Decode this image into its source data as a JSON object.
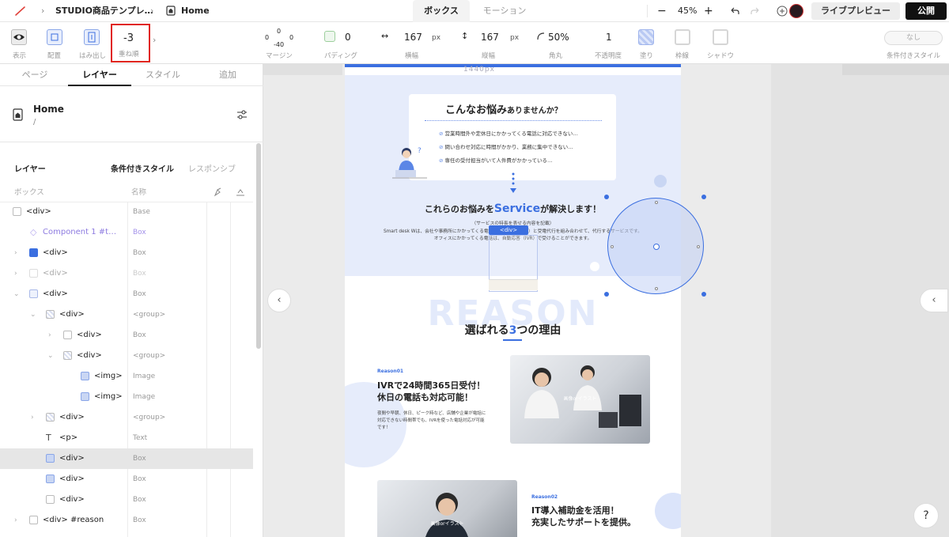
{
  "topbar": {
    "breadcrumb_project": "STUDIO商品テンプレ…",
    "breadcrumb_page": "Home",
    "tab_box": "ボックス",
    "tab_motion": "モーション",
    "zoom_minus": "−",
    "zoom": "45%",
    "zoom_plus": "+",
    "live_preview": "ライブプレビュー",
    "publish": "公開"
  },
  "toolbar": {
    "show": "表示",
    "place": "配置",
    "overflow": "はみ出し",
    "zindex_value": "-3",
    "zindex_label": "重ね順",
    "margin_top": "0",
    "margin_left": "0",
    "margin_right": "0",
    "margin_bottom": "-40",
    "margin_label": "マージン",
    "padding_value": "0",
    "padding_label": "パディング",
    "width_value": "167",
    "width_unit": "px",
    "width_label": "横幅",
    "height_value": "167",
    "height_unit": "px",
    "height_label": "縦幅",
    "radius_value": "50%",
    "radius_label": "角丸",
    "opacity_value": "1",
    "opacity_label": "不透明度",
    "fill_label": "塗り",
    "border_label": "枠線",
    "shadow_label": "シャドウ",
    "conditional_value": "なし",
    "conditional_label": "条件付きスタイル"
  },
  "panel": {
    "tabs": [
      "ページ",
      "レイヤー",
      "スタイル",
      "追加"
    ],
    "page_title": "Home",
    "page_path": "/",
    "section_title": "レイヤー",
    "subtab_conditional": "条件付きスタイル",
    "subtab_responsive": "レスポンシブ",
    "col_box": "ボックス",
    "col_name": "名称",
    "rows": [
      {
        "name": "<div>",
        "type": "Base"
      },
      {
        "name": "Component 1 #t…",
        "type": "Box"
      },
      {
        "name": "<div>",
        "type": "Box"
      },
      {
        "name": "<div>",
        "type": "Box"
      },
      {
        "name": "<div>",
        "type": "Box"
      },
      {
        "name": "<div>",
        "type": "<group>"
      },
      {
        "name": "<div>",
        "type": "Box"
      },
      {
        "name": "<div>",
        "type": "<group>"
      },
      {
        "name": "<img>",
        "type": "Image"
      },
      {
        "name": "<img>",
        "type": "Image"
      },
      {
        "name": "<div>",
        "type": "<group>"
      },
      {
        "name": "<p>",
        "type": "Text"
      },
      {
        "name": "<div>",
        "type": "Box"
      },
      {
        "name": "<div>",
        "type": "Box"
      },
      {
        "name": "<div>",
        "type": "Box"
      },
      {
        "name": "<div> #reason",
        "type": "Box"
      }
    ]
  },
  "canvas": {
    "width_label": "1440px",
    "worry_title_a": "こんなお悩み",
    "worry_title_b": "ありませんか？",
    "worries": [
      "営業時間外や定休日にかかってくる電話に対応できない…",
      "問い合わせ対応に時間がかかり、業務に集中できない…",
      "専任の受付担当がいて人件費がかかっている…"
    ],
    "solve_a": "これらのお悩みを",
    "solve_b": "Service",
    "solve_c": "が解決します！",
    "solve_sub1": "（サービスの特長を表せる内容を記載）",
    "solve_sub2": "Smart desk Wは、会社や事務所にかかってくる電話を自動応答（IVR）と受電代行を組み合わせて、代行するサービスです。",
    "solve_sub3": "オフィスにかかってくる電話は、自動応答（IVR）で受けることができます。",
    "div_tag": "<div>",
    "reason_bg": "REASON",
    "reason_title_a": "選ばれる",
    "reason_title_b": "3",
    "reason_title_c": "つの理由",
    "r1_label": "Reason01",
    "r1_title1": "IVRで24時間365日受付！",
    "r1_title2": "休日の電話も対応可能！",
    "r1_body1": "夜間や早朝、休日、ピーク時など、店舗や企業が電話に",
    "r1_body2": "対応できない時間帯でも、IVRを使った電話対応が可能",
    "r1_body3": "です！",
    "r1_img": "画像orイラスト",
    "r2_label": "Reason02",
    "r2_title1": "IT導入補助金を活用！",
    "r2_title2": "充実したサポートを提供。",
    "r2_img": "画像orイラスト",
    "help": "?"
  }
}
